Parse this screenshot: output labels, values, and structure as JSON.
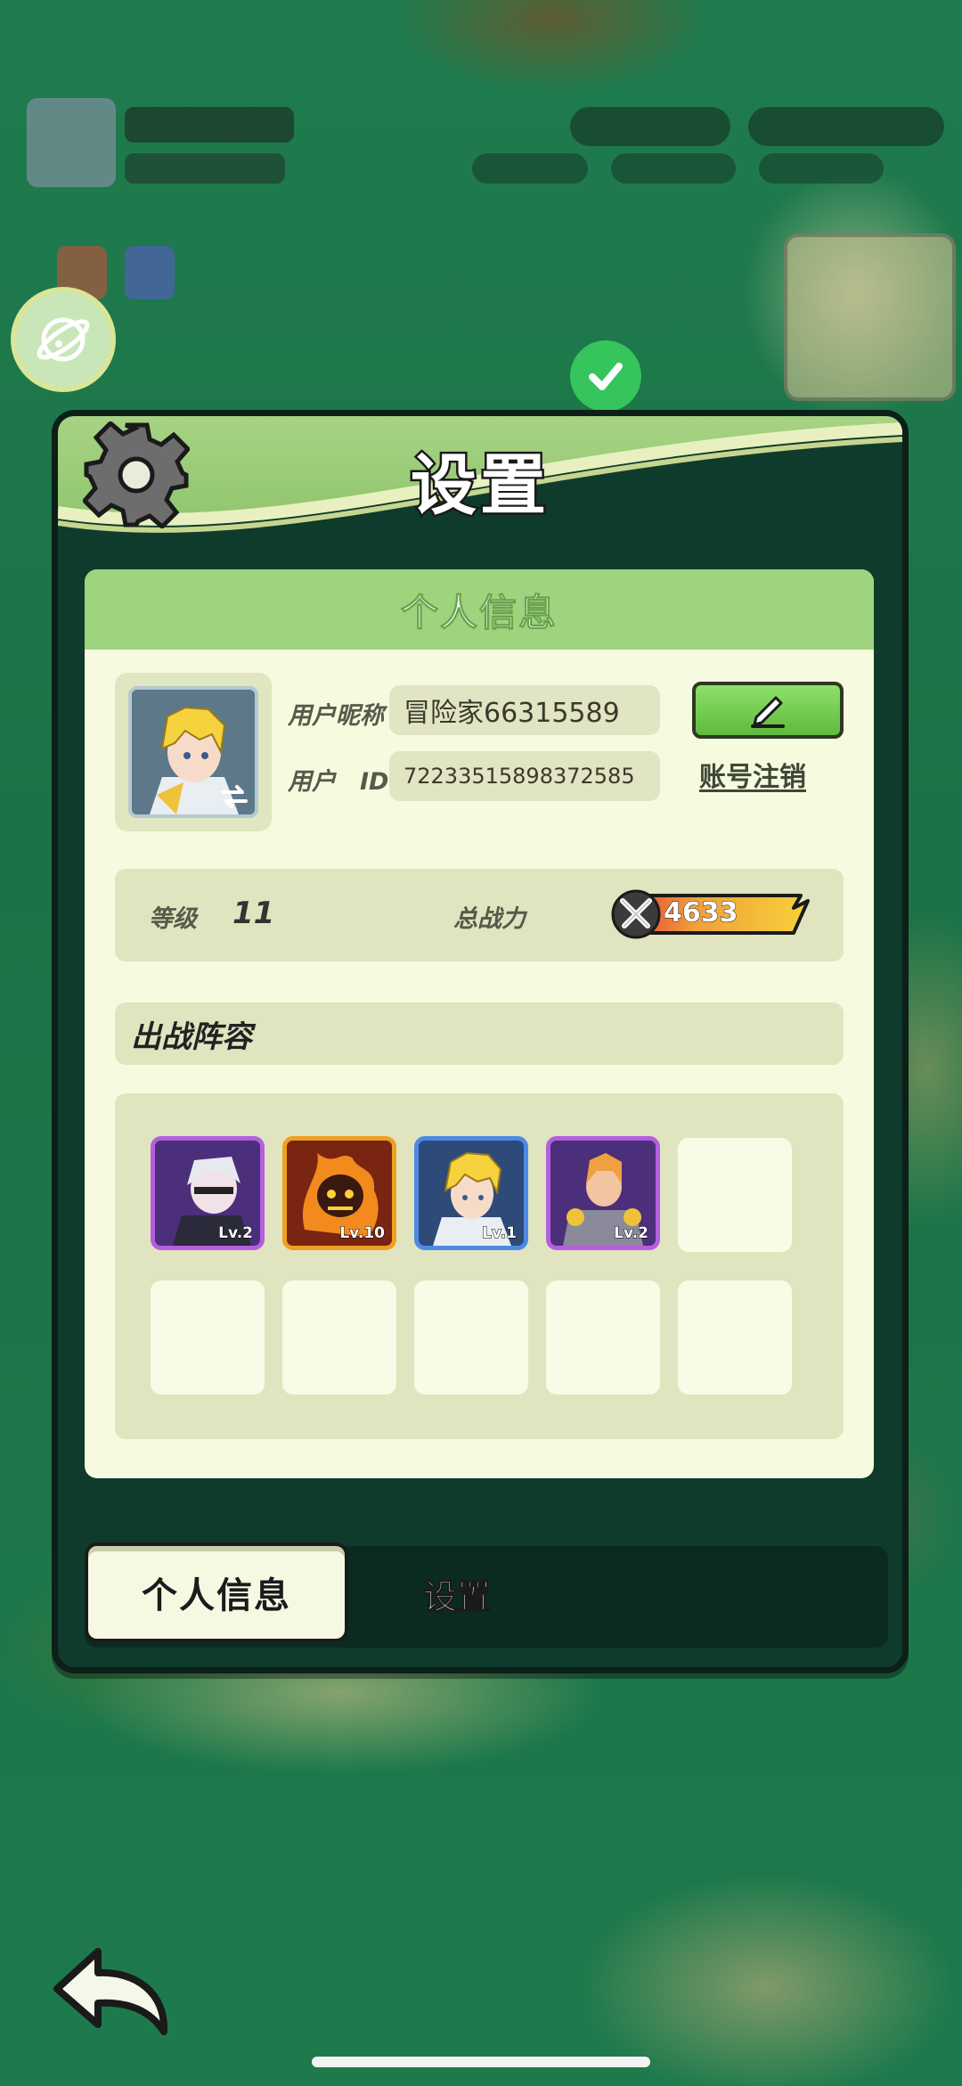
{
  "dialog": {
    "title": "设置"
  },
  "profile": {
    "section_title": "个人信息",
    "nickname_label": "用户昵称",
    "nickname_value": "冒险家66315589",
    "id_label": "用户　ID",
    "id_value": "72233515898372585",
    "logout_label": "账号注销"
  },
  "stats": {
    "level_label": "等级",
    "level_value": "11",
    "power_label": "总战力",
    "power_value": "4633"
  },
  "lineup": {
    "title": "出战阵容",
    "heroes": [
      {
        "level": "Lv.2",
        "rarity": "purple"
      },
      {
        "level": "Lv.10",
        "rarity": "orange"
      },
      {
        "level": "Lv.1",
        "rarity": "blue"
      },
      {
        "level": "Lv.2",
        "rarity": "purple"
      }
    ],
    "empty_slots": 6
  },
  "tabs": {
    "profile": "个人信息",
    "settings": "设置"
  },
  "icons": {
    "header": "gear-icon",
    "edit": "pencil-icon",
    "power": "crossed-swords-icon",
    "back": "back-arrow-icon",
    "planet": "planet-icon"
  },
  "colors": {
    "header_green": "#9ed47d",
    "card_bg": "#f6fadf",
    "edit_btn": "#6fcd4c",
    "power_bar": "#f5c22e"
  }
}
